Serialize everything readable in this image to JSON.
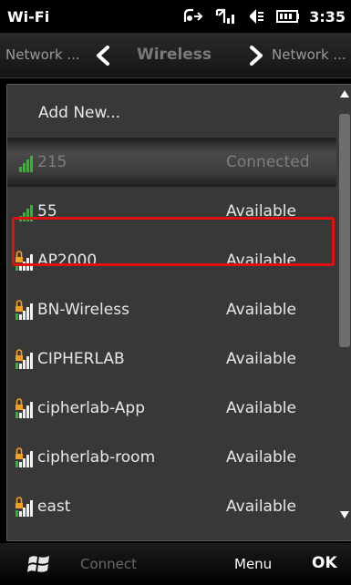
{
  "status_bar": {
    "app_title": "Wi-Fi",
    "time": "3:35",
    "icons": [
      "network-activity-icon",
      "signal-icon",
      "volume-icon",
      "battery-icon"
    ]
  },
  "tabs": {
    "previous": "Network ...",
    "current": "Wireless",
    "next": "Network ..."
  },
  "list": {
    "add_new": "Add New...",
    "networks": [
      {
        "ssid": "215",
        "status": "Connected",
        "secured": false,
        "selected": true
      },
      {
        "ssid": "55",
        "status": "Available",
        "secured": false,
        "selected": false
      },
      {
        "ssid": "AP2000",
        "status": "Available",
        "secured": true,
        "selected": false
      },
      {
        "ssid": "BN-Wireless",
        "status": "Available",
        "secured": true,
        "selected": false
      },
      {
        "ssid": "CIPHERLAB",
        "status": "Available",
        "secured": true,
        "selected": false
      },
      {
        "ssid": "cipherlab-App",
        "status": "Available",
        "secured": true,
        "selected": false
      },
      {
        "ssid": "cipherlab-room",
        "status": "Available",
        "secured": true,
        "selected": false
      },
      {
        "ssid": "east",
        "status": "Available",
        "secured": true,
        "selected": false
      }
    ]
  },
  "command_bar": {
    "connect": "Connect",
    "menu": "Menu",
    "ok": "OK"
  },
  "colors": {
    "highlight": "#e01010",
    "signal_green": "#22c21e",
    "lock_orange": "#f2a020"
  }
}
